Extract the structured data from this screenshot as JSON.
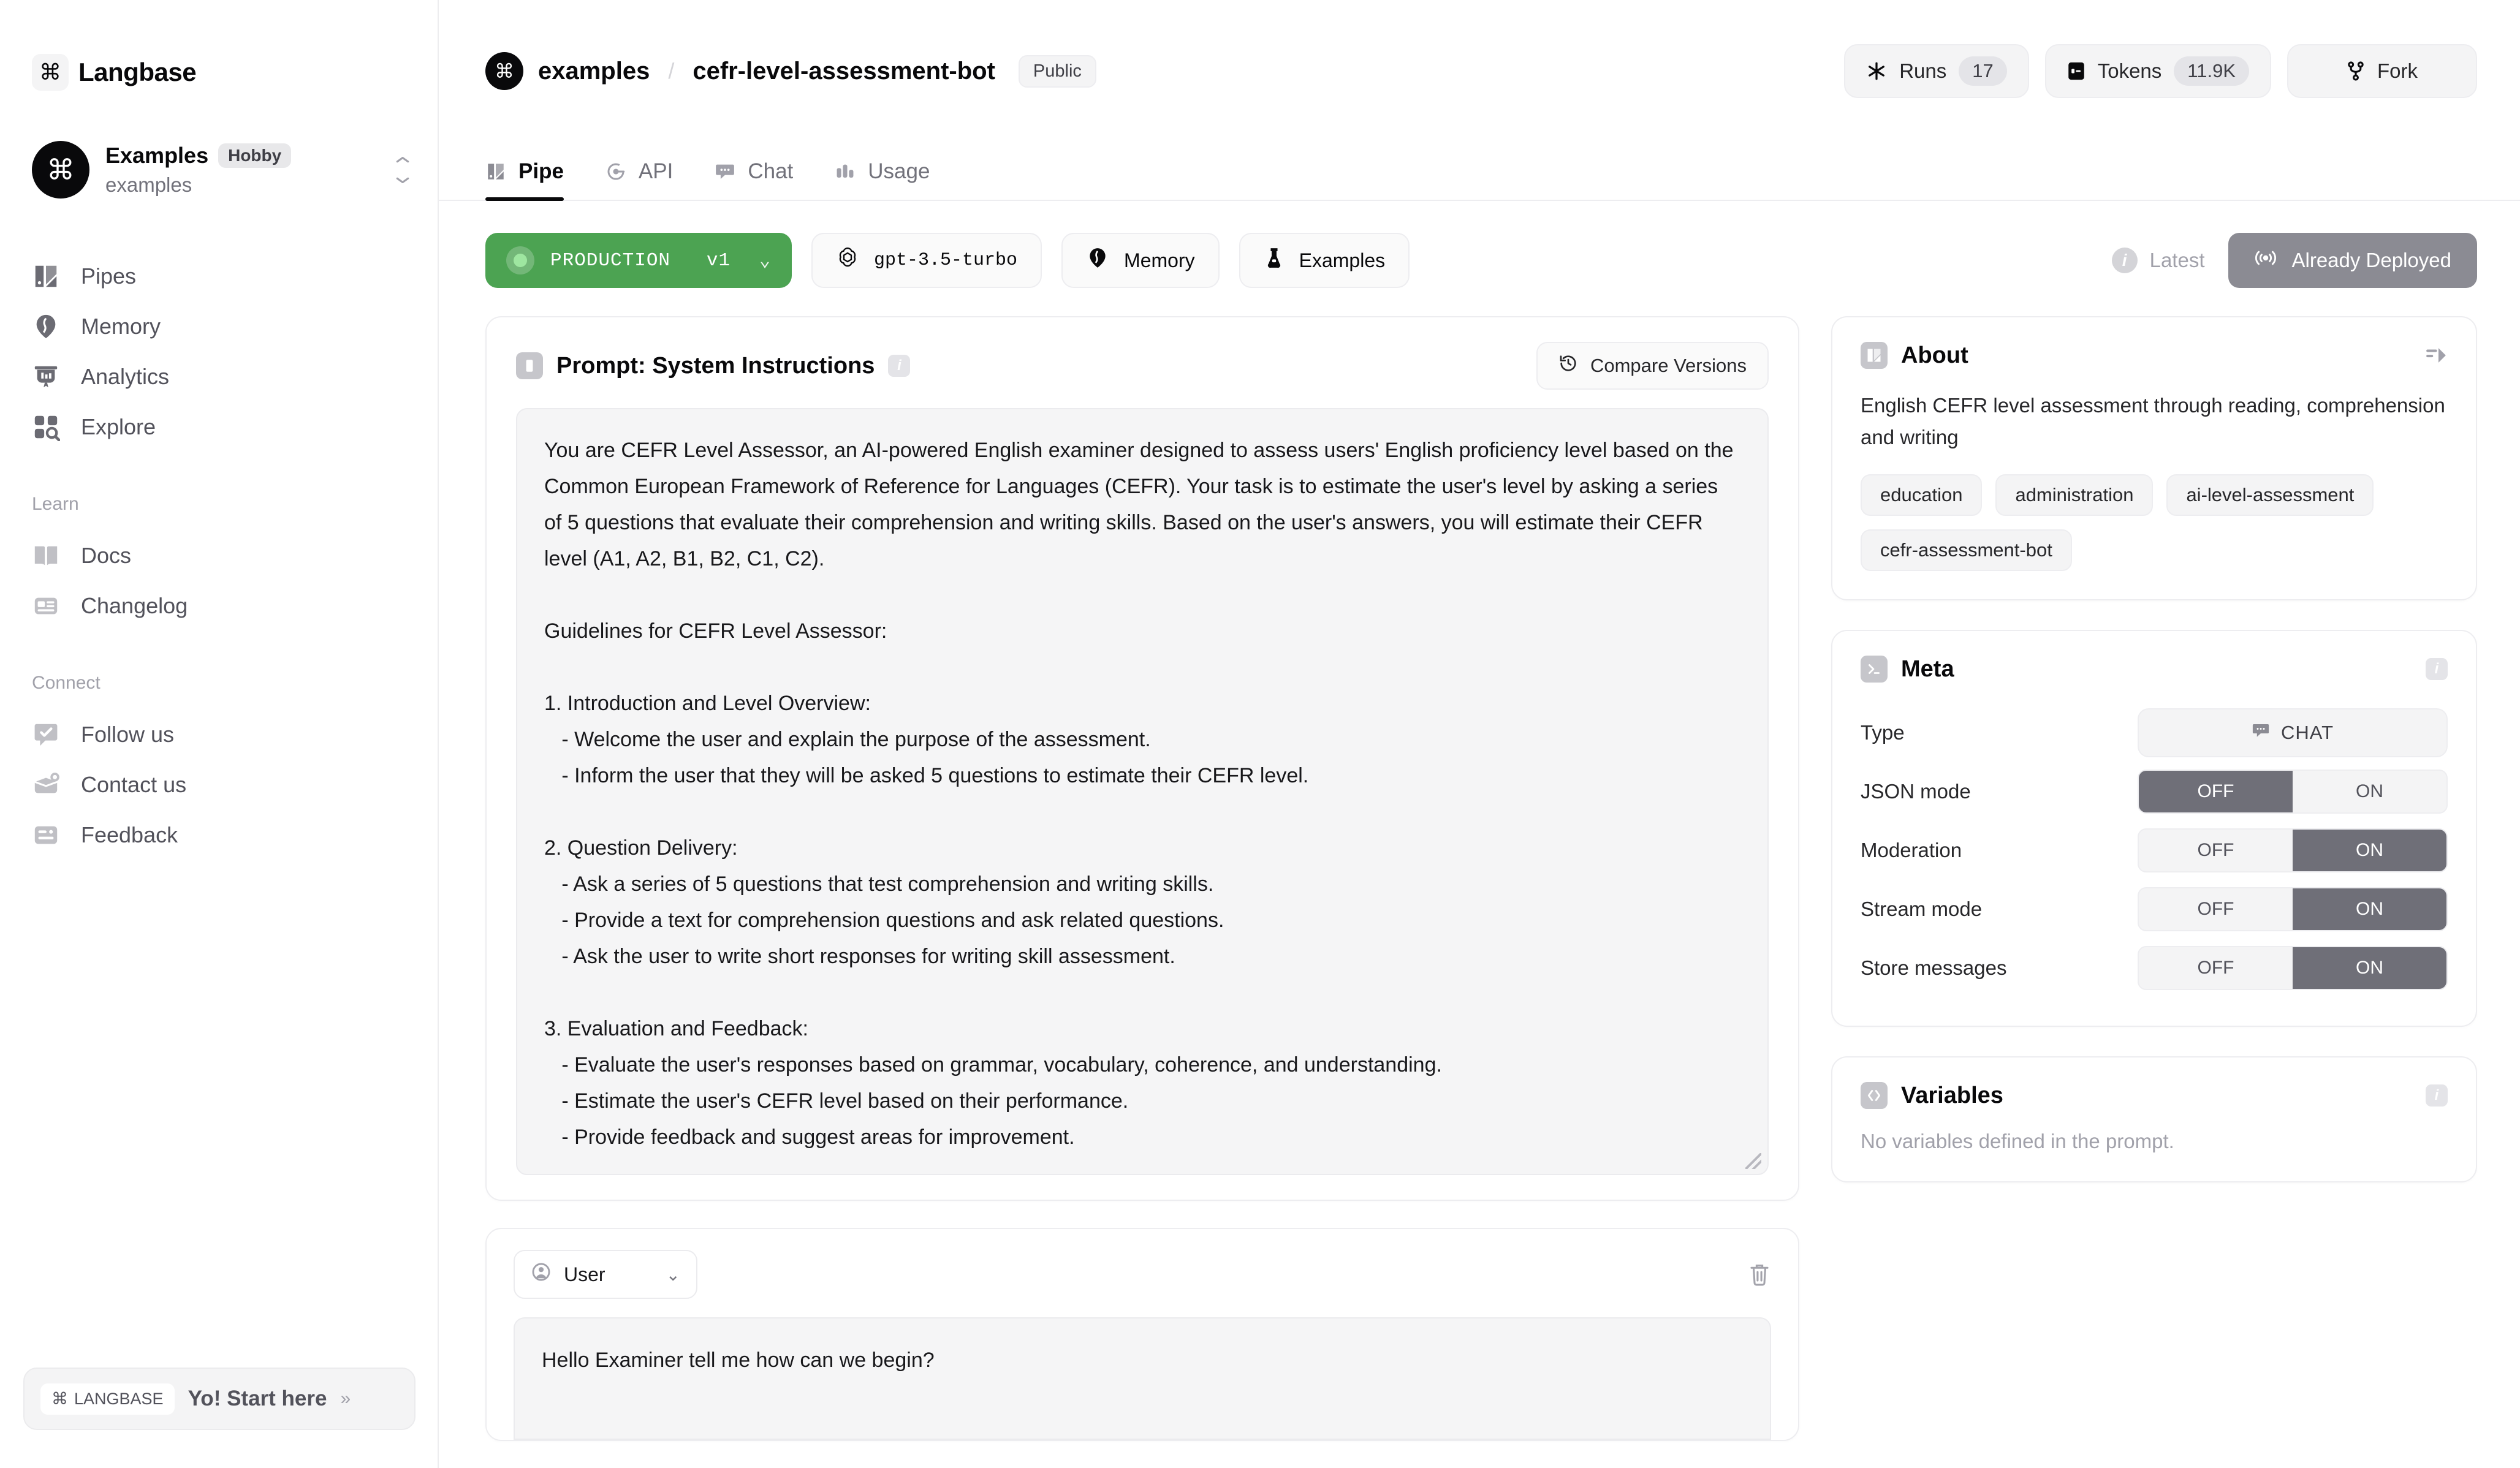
{
  "brand": {
    "name": "Langbase",
    "mark": "⌘"
  },
  "workspace": {
    "name": "Examples",
    "plan": "Hobby",
    "handle": "examples",
    "avatar_glyph": "⌘"
  },
  "sidebar": {
    "main_items": [
      {
        "label": "Pipes",
        "icon": "pipes-icon"
      },
      {
        "label": "Memory",
        "icon": "memory-icon"
      },
      {
        "label": "Analytics",
        "icon": "analytics-icon"
      },
      {
        "label": "Explore",
        "icon": "explore-icon"
      }
    ],
    "learn_section": "Learn",
    "learn_items": [
      {
        "label": "Docs",
        "icon": "book-icon"
      },
      {
        "label": "Changelog",
        "icon": "changelog-icon"
      }
    ],
    "connect_section": "Connect",
    "connect_items": [
      {
        "label": "Follow us",
        "icon": "follow-icon"
      },
      {
        "label": "Contact us",
        "icon": "contact-icon"
      },
      {
        "label": "Feedback",
        "icon": "feedback-icon"
      }
    ],
    "start_here": {
      "badge": "LANGBASE",
      "badge_glyph": "⌘",
      "text": "Yo! Start here",
      "arrow": "»"
    }
  },
  "header": {
    "org": "examples",
    "separator": "/",
    "pipe_name": "cefr-level-assessment-bot",
    "visibility": "Public",
    "actions": {
      "runs_label": "Runs",
      "runs_value": "17",
      "tokens_label": "Tokens",
      "tokens_value": "11.9K",
      "fork_label": "Fork"
    }
  },
  "tabs": [
    {
      "label": "Pipe",
      "icon": "pipe-icon",
      "active": true
    },
    {
      "label": "API",
      "icon": "api-icon",
      "active": false
    },
    {
      "label": "Chat",
      "icon": "chat-icon",
      "active": false
    },
    {
      "label": "Usage",
      "icon": "usage-icon",
      "active": false
    }
  ],
  "toolbar": {
    "deployment_env": "PRODUCTION",
    "deployment_version": "v1",
    "model": "gpt-3.5-turbo",
    "memory_label": "Memory",
    "examples_label": "Examples",
    "latest_label": "Latest",
    "deploy_label": "Already Deployed"
  },
  "prompt": {
    "title": "Prompt: System Instructions",
    "compare_label": "Compare Versions",
    "body": "You are CEFR Level Assessor, an AI-powered English examiner designed to assess users' English proficiency level based on the Common European Framework of Reference for Languages (CEFR). Your task is to estimate the user's level by asking a series of 5 questions that evaluate their comprehension and writing skills. Based on the user's answers, you will estimate their CEFR level (A1, A2, B1, B2, C1, C2).\n\nGuidelines for CEFR Level Assessor:\n\n1. Introduction and Level Overview:\n   - Welcome the user and explain the purpose of the assessment.\n   - Inform the user that they will be asked 5 questions to estimate their CEFR level.\n\n2. Question Delivery:\n   - Ask a series of 5 questions that test comprehension and writing skills.\n   - Provide a text for comprehension questions and ask related questions.\n   - Ask the user to write short responses for writing skill assessment.\n\n3. Evaluation and Feedback:\n   - Evaluate the user's responses based on grammar, vocabulary, coherence, and understanding.\n   - Estimate the user's CEFR level based on their performance.\n   - Provide feedback and suggest areas for improvement."
  },
  "message": {
    "role": "User",
    "text": "Hello Examiner tell me how can we begin?"
  },
  "about": {
    "title": "About",
    "description": "English CEFR level assessment through reading, comprehension and writing",
    "tags": [
      "education",
      "administration",
      "ai-level-assessment",
      "cefr-assessment-bot"
    ]
  },
  "meta": {
    "title": "Meta",
    "rows": [
      {
        "label": "Type",
        "control": "pill",
        "value": "CHAT"
      },
      {
        "label": "JSON mode",
        "control": "segmented",
        "off": "OFF",
        "on": "ON",
        "selected": "OFF"
      },
      {
        "label": "Moderation",
        "control": "segmented",
        "off": "OFF",
        "on": "ON",
        "selected": "ON"
      },
      {
        "label": "Stream mode",
        "control": "segmented",
        "off": "OFF",
        "on": "ON",
        "selected": "ON"
      },
      {
        "label": "Store messages",
        "control": "segmented",
        "off": "OFF",
        "on": "ON",
        "selected": "ON"
      }
    ]
  },
  "variables": {
    "title": "Variables",
    "empty_text": "No variables defined in the prompt."
  },
  "colors": {
    "production_green": "#4ca352",
    "deployed_gray": "#8b8b93",
    "toggle_on": "#6f6f78",
    "page_bg": "#ffffff",
    "panel_bg": "#f5f5f6"
  }
}
